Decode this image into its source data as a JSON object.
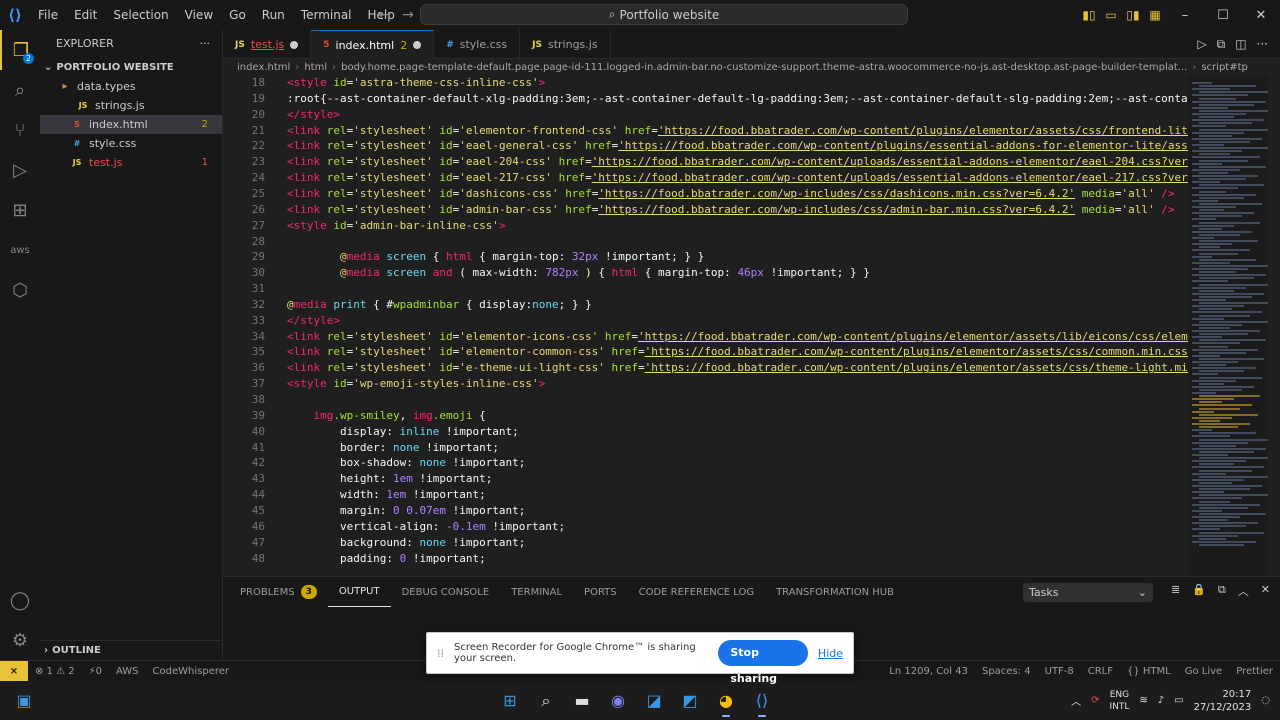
{
  "titlebar": {
    "menu": [
      "File",
      "Edit",
      "Selection",
      "View",
      "Go",
      "Run",
      "Terminal",
      "Help"
    ],
    "search_text": "Portfolio website"
  },
  "activity": {
    "explorer_badge": "2"
  },
  "sidebar": {
    "title": "EXPLORER",
    "project": "PORTFOLIO WEBSITE",
    "items": [
      {
        "label": "data.types",
        "type": "folder",
        "badge": ""
      },
      {
        "label": "strings.js",
        "type": "js",
        "badge": ""
      },
      {
        "label": "index.html",
        "type": "html",
        "badge": "2"
      },
      {
        "label": "style.css",
        "type": "css",
        "badge": ""
      },
      {
        "label": "test.js",
        "type": "js",
        "badge": "1"
      }
    ],
    "outline": "OUTLINE"
  },
  "tabs": [
    {
      "label": "test.js",
      "icon": "JS",
      "count": ""
    },
    {
      "label": "index.html",
      "icon": "5",
      "count": "2"
    },
    {
      "label": "style.css",
      "icon": "#",
      "count": ""
    },
    {
      "label": "strings.js",
      "icon": "JS",
      "count": ""
    }
  ],
  "breadcrumb": {
    "items": [
      "index.html",
      "html",
      "body.home.page-template-default.page.page-id-111.logged-in.admin-bar.no-customize-support.theme-astra.woocommerce-no-js.ast-desktop.ast-page-builder-templat...",
      "script#tp"
    ]
  },
  "code": [
    {
      "n": "18",
      "segs": [
        [
          "t-tag",
          "<style "
        ],
        [
          "t-attr",
          "id"
        ],
        [
          "t-punc",
          "="
        ],
        [
          "t-str",
          "'astra-theme-css-inline-css'"
        ],
        [
          "t-tag",
          ">"
        ]
      ]
    },
    {
      "n": "19",
      "segs": [
        [
          "t-plain",
          ":root{--ast-container-default-xlg-padding:3em;--ast-container-default-lg-padding:3em;--ast-container-default-slg-padding:2em;--ast-container-"
        ]
      ]
    },
    {
      "n": "20",
      "segs": [
        [
          "t-tag",
          "</style>"
        ]
      ]
    },
    {
      "n": "21",
      "segs": [
        [
          "t-tag",
          "<link "
        ],
        [
          "t-attr",
          "rel"
        ],
        [
          "t-punc",
          "="
        ],
        [
          "t-str",
          "'stylesheet' "
        ],
        [
          "t-attr",
          "id"
        ],
        [
          "t-punc",
          "="
        ],
        [
          "t-str",
          "'elementor-frontend-css' "
        ],
        [
          "t-attr",
          "href"
        ],
        [
          "t-punc",
          "="
        ],
        [
          "t-url",
          "'https://food.bbatrader.com/wp-content/plugins/elementor/assets/css/frontend-lite.min"
        ]
      ]
    },
    {
      "n": "22",
      "segs": [
        [
          "t-tag",
          "<link "
        ],
        [
          "t-attr",
          "rel"
        ],
        [
          "t-punc",
          "="
        ],
        [
          "t-str",
          "'stylesheet' "
        ],
        [
          "t-attr",
          "id"
        ],
        [
          "t-punc",
          "="
        ],
        [
          "t-str",
          "'eael-general-css' "
        ],
        [
          "t-attr",
          "href"
        ],
        [
          "t-punc",
          "="
        ],
        [
          "t-url",
          "'https://food.bbatrader.com/wp-content/plugins/essential-addons-for-elementor-lite/assets/"
        ]
      ]
    },
    {
      "n": "23",
      "segs": [
        [
          "t-tag",
          "<link "
        ],
        [
          "t-attr",
          "rel"
        ],
        [
          "t-punc",
          "="
        ],
        [
          "t-str",
          "'stylesheet' "
        ],
        [
          "t-attr",
          "id"
        ],
        [
          "t-punc",
          "="
        ],
        [
          "t-str",
          "'eael-204-css' "
        ],
        [
          "t-attr",
          "href"
        ],
        [
          "t-punc",
          "="
        ],
        [
          "t-url",
          "'https://food.bbatrader.com/wp-content/uploads/essential-addons-elementor/eael-204.css?ver=1700"
        ]
      ]
    },
    {
      "n": "24",
      "segs": [
        [
          "t-tag",
          "<link "
        ],
        [
          "t-attr",
          "rel"
        ],
        [
          "t-punc",
          "="
        ],
        [
          "t-str",
          "'stylesheet' "
        ],
        [
          "t-attr",
          "id"
        ],
        [
          "t-punc",
          "="
        ],
        [
          "t-str",
          "'eael-217-css' "
        ],
        [
          "t-attr",
          "href"
        ],
        [
          "t-punc",
          "="
        ],
        [
          "t-url",
          "'https://food.bbatrader.com/wp-content/uploads/essential-addons-elementor/eael-217.css?ver=1700"
        ]
      ]
    },
    {
      "n": "25",
      "segs": [
        [
          "t-tag",
          "<link "
        ],
        [
          "t-attr",
          "rel"
        ],
        [
          "t-punc",
          "="
        ],
        [
          "t-str",
          "'stylesheet' "
        ],
        [
          "t-attr",
          "id"
        ],
        [
          "t-punc",
          "="
        ],
        [
          "t-str",
          "'dashicons-css' "
        ],
        [
          "t-attr",
          "href"
        ],
        [
          "t-punc",
          "="
        ],
        [
          "t-url",
          "'https://food.bbatrader.com/wp-includes/css/dashicons.min.css?ver=6.4.2'"
        ],
        [
          "t-plain",
          " "
        ],
        [
          "t-attr",
          "media"
        ],
        [
          "t-punc",
          "="
        ],
        [
          "t-str",
          "'all'"
        ],
        [
          "t-tag",
          " />"
        ]
      ]
    },
    {
      "n": "26",
      "segs": [
        [
          "t-tag",
          "<link "
        ],
        [
          "t-attr",
          "rel"
        ],
        [
          "t-punc",
          "="
        ],
        [
          "t-str",
          "'stylesheet' "
        ],
        [
          "t-attr",
          "id"
        ],
        [
          "t-punc",
          "="
        ],
        [
          "t-str",
          "'admin-bar-css' "
        ],
        [
          "t-attr",
          "href"
        ],
        [
          "t-punc",
          "="
        ],
        [
          "t-url",
          "'https://food.bbatrader.com/wp-includes/css/admin-bar.min.css?ver=6.4.2'"
        ],
        [
          "t-plain",
          " "
        ],
        [
          "t-attr",
          "media"
        ],
        [
          "t-punc",
          "="
        ],
        [
          "t-str",
          "'all'"
        ],
        [
          "t-tag",
          " />"
        ]
      ]
    },
    {
      "n": "27",
      "segs": [
        [
          "t-tag",
          "<style "
        ],
        [
          "t-attr",
          "id"
        ],
        [
          "t-punc",
          "="
        ],
        [
          "t-str",
          "'admin-bar-inline-css'"
        ],
        [
          "t-tag",
          ">"
        ]
      ]
    },
    {
      "n": "28",
      "segs": []
    },
    {
      "n": "29",
      "segs": [
        [
          "t-plain",
          "        "
        ],
        [
          "t-at",
          "@"
        ],
        [
          "t-kw",
          "media "
        ],
        [
          "t-val",
          "screen "
        ],
        [
          "t-punc",
          "{ "
        ],
        [
          "t-tag",
          "html "
        ],
        [
          "t-punc",
          "{ "
        ],
        [
          "t-plain",
          "margin-top: "
        ],
        [
          "t-num",
          "32px "
        ],
        [
          "t-plain",
          "!important; } }"
        ]
      ]
    },
    {
      "n": "30",
      "segs": [
        [
          "t-plain",
          "        "
        ],
        [
          "t-at",
          "@"
        ],
        [
          "t-kw",
          "media "
        ],
        [
          "t-val",
          "screen "
        ],
        [
          "t-kw",
          "and "
        ],
        [
          "t-punc",
          "( "
        ],
        [
          "t-plain",
          "max-width: "
        ],
        [
          "t-num",
          "782px "
        ],
        [
          "t-punc",
          ") { "
        ],
        [
          "t-tag",
          "html "
        ],
        [
          "t-punc",
          "{ "
        ],
        [
          "t-plain",
          "margin-top: "
        ],
        [
          "t-num",
          "46px "
        ],
        [
          "t-plain",
          "!important; } }"
        ]
      ]
    },
    {
      "n": "31",
      "segs": []
    },
    {
      "n": "32",
      "segs": [
        [
          "t-at",
          "@"
        ],
        [
          "t-kw",
          "media "
        ],
        [
          "t-val",
          "print "
        ],
        [
          "t-punc",
          "{ "
        ],
        [
          "t-plain",
          "#"
        ],
        [
          "t-attr",
          "wpadminbar "
        ],
        [
          "t-punc",
          "{ "
        ],
        [
          "t-plain",
          "display:"
        ],
        [
          "t-val",
          "none"
        ],
        [
          "t-plain",
          "; } }"
        ]
      ]
    },
    {
      "n": "33",
      "segs": [
        [
          "t-tag",
          "</style>"
        ]
      ]
    },
    {
      "n": "34",
      "segs": [
        [
          "t-tag",
          "<link "
        ],
        [
          "t-attr",
          "rel"
        ],
        [
          "t-punc",
          "="
        ],
        [
          "t-str",
          "'stylesheet' "
        ],
        [
          "t-attr",
          "id"
        ],
        [
          "t-punc",
          "="
        ],
        [
          "t-str",
          "'elementor-icons-css' "
        ],
        [
          "t-attr",
          "href"
        ],
        [
          "t-punc",
          "="
        ],
        [
          "t-url",
          "'https://food.bbatrader.com/wp-content/plugins/elementor/assets/lib/eicons/css/elementor"
        ]
      ]
    },
    {
      "n": "35",
      "segs": [
        [
          "t-tag",
          "<link "
        ],
        [
          "t-attr",
          "rel"
        ],
        [
          "t-punc",
          "="
        ],
        [
          "t-str",
          "'stylesheet' "
        ],
        [
          "t-attr",
          "id"
        ],
        [
          "t-punc",
          "="
        ],
        [
          "t-str",
          "'elementor-common-css' "
        ],
        [
          "t-attr",
          "href"
        ],
        [
          "t-punc",
          "="
        ],
        [
          "t-url",
          "'https://food.bbatrader.com/wp-content/plugins/elementor/assets/css/common.min.css?ver="
        ]
      ]
    },
    {
      "n": "36",
      "segs": [
        [
          "t-tag",
          "<link "
        ],
        [
          "t-attr",
          "rel"
        ],
        [
          "t-punc",
          "="
        ],
        [
          "t-str",
          "'stylesheet' "
        ],
        [
          "t-attr",
          "id"
        ],
        [
          "t-punc",
          "="
        ],
        [
          "t-str",
          "'e-theme-ui-light-css' "
        ],
        [
          "t-attr",
          "href"
        ],
        [
          "t-punc",
          "="
        ],
        [
          "t-url",
          "'https://food.bbatrader.com/wp-content/plugins/elementor/assets/css/theme-light.min.css"
        ]
      ]
    },
    {
      "n": "37",
      "segs": [
        [
          "t-tag",
          "<style "
        ],
        [
          "t-attr",
          "id"
        ],
        [
          "t-punc",
          "="
        ],
        [
          "t-str",
          "'wp-emoji-styles-inline-css'"
        ],
        [
          "t-tag",
          ">"
        ]
      ]
    },
    {
      "n": "38",
      "segs": []
    },
    {
      "n": "39",
      "segs": [
        [
          "t-plain",
          "    "
        ],
        [
          "t-tag",
          "img"
        ],
        [
          "t-attr",
          ".wp-smiley"
        ],
        [
          "t-plain",
          ", "
        ],
        [
          "t-tag",
          "img"
        ],
        [
          "t-attr",
          ".emoji "
        ],
        [
          "t-punc",
          "{"
        ]
      ]
    },
    {
      "n": "40",
      "segs": [
        [
          "t-plain",
          "        display: "
        ],
        [
          "t-val",
          "inline "
        ],
        [
          "t-plain",
          "!important;"
        ]
      ]
    },
    {
      "n": "41",
      "segs": [
        [
          "t-plain",
          "        border: "
        ],
        [
          "t-val",
          "none "
        ],
        [
          "t-plain",
          "!important;"
        ]
      ]
    },
    {
      "n": "42",
      "segs": [
        [
          "t-plain",
          "        box-shadow: "
        ],
        [
          "t-val",
          "none "
        ],
        [
          "t-plain",
          "!important;"
        ]
      ]
    },
    {
      "n": "43",
      "segs": [
        [
          "t-plain",
          "        height: "
        ],
        [
          "t-num",
          "1em "
        ],
        [
          "t-plain",
          "!important;"
        ]
      ]
    },
    {
      "n": "44",
      "segs": [
        [
          "t-plain",
          "        width: "
        ],
        [
          "t-num",
          "1em "
        ],
        [
          "t-plain",
          "!important;"
        ]
      ]
    },
    {
      "n": "45",
      "segs": [
        [
          "t-plain",
          "        margin: "
        ],
        [
          "t-num",
          "0 0.07em "
        ],
        [
          "t-plain",
          "!important;"
        ]
      ]
    },
    {
      "n": "46",
      "segs": [
        [
          "t-plain",
          "        vertical-align: "
        ],
        [
          "t-num",
          "-0.1em "
        ],
        [
          "t-plain",
          "!important;"
        ]
      ]
    },
    {
      "n": "47",
      "segs": [
        [
          "t-plain",
          "        background: "
        ],
        [
          "t-val",
          "none "
        ],
        [
          "t-plain",
          "!important;"
        ]
      ]
    },
    {
      "n": "48",
      "segs": [
        [
          "t-plain",
          "        padding: "
        ],
        [
          "t-num",
          "0 "
        ],
        [
          "t-plain",
          "!important;"
        ]
      ]
    }
  ],
  "panel": {
    "tabs": [
      "PROBLEMS",
      "OUTPUT",
      "DEBUG CONSOLE",
      "TERMINAL",
      "PORTS",
      "CODE REFERENCE LOG",
      "TRANSFORMATION HUB"
    ],
    "problems_count": "3",
    "active": "OUTPUT",
    "tasks_select": "Tasks"
  },
  "share": {
    "message": "Screen Recorder for Google Chrome™ is sharing your screen.",
    "stop": "Stop sharing",
    "hide": "Hide"
  },
  "status": {
    "left": [
      "⊗ 1 ⚠ 2",
      "⚡0",
      "AWS",
      "CodeWhisperer"
    ],
    "right": [
      "Ln 1209, Col 43",
      "Spaces: 4",
      "UTF-8",
      "CRLF",
      "{} HTML",
      "Go Live",
      "Prettier"
    ]
  },
  "taskbar": {
    "lang": "ENG",
    "lang_sub": "INTL",
    "time": "20:17",
    "date": "27/12/2023"
  },
  "colors": {
    "accent": "#0078d4",
    "remote": "#e8c33a",
    "error": "#f14c4c",
    "warning": "#cca700"
  }
}
